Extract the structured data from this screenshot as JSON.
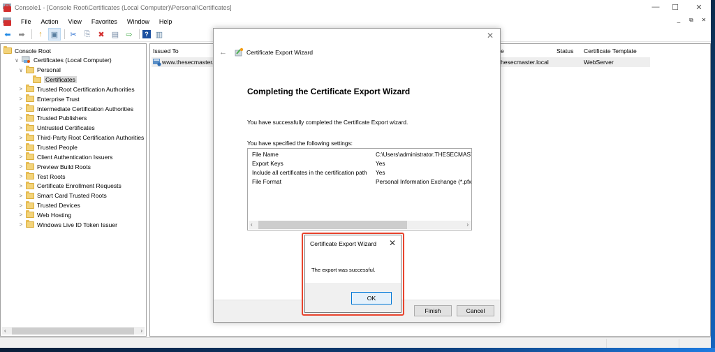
{
  "window": {
    "title": "Console1 - [Console Root\\Certificates (Local Computer)\\Personal\\Certificates]",
    "controls": {
      "minimize": "—",
      "maximize": "☐",
      "close": "✕"
    },
    "mdi_controls": {
      "minimize": "_",
      "restore": "⧉",
      "close": "✕"
    }
  },
  "menu": [
    "File",
    "Action",
    "View",
    "Favorites",
    "Window",
    "Help"
  ],
  "toolbar": [
    {
      "name": "back-icon",
      "glyph": "⬅",
      "color": "#1e88e5"
    },
    {
      "name": "forward-icon",
      "glyph": "➡",
      "color": "#888888"
    },
    {
      "name": "up-folder-icon",
      "glyph": "↑",
      "color": "#d9a52a"
    },
    {
      "name": "show-hide-tree-icon",
      "glyph": "▣",
      "color": "#5a7fa0"
    },
    {
      "name": "cut-icon",
      "glyph": "✂",
      "color": "#2a6fd0"
    },
    {
      "name": "copy-icon",
      "glyph": "⎘",
      "color": "#7a8ea8"
    },
    {
      "name": "delete-icon",
      "glyph": "✖",
      "color": "#d32f2f"
    },
    {
      "name": "properties-icon",
      "glyph": "▤",
      "color": "#7a8ea8"
    },
    {
      "name": "export-list-icon",
      "glyph": "⇨",
      "color": "#4caf50"
    },
    {
      "name": "help-icon",
      "glyph": "?",
      "color": "#1a4fa0"
    },
    {
      "name": "show-action-pane-icon",
      "glyph": "▥",
      "color": "#5a7fa0"
    }
  ],
  "tree": [
    {
      "label": "Console Root",
      "level": 0,
      "chevron": ""
    },
    {
      "label": "Certificates (Local Computer)",
      "level": 1,
      "chevron": "∨"
    },
    {
      "label": "Personal",
      "level": 2,
      "chevron": "∨"
    },
    {
      "label": "Certificates",
      "level": 3,
      "chevron": "",
      "selected": true
    },
    {
      "label": "Trusted Root Certification Authorities",
      "level": 2,
      "chevron": ">"
    },
    {
      "label": "Enterprise Trust",
      "level": 2,
      "chevron": ">"
    },
    {
      "label": "Intermediate Certification Authorities",
      "level": 2,
      "chevron": ">"
    },
    {
      "label": "Trusted Publishers",
      "level": 2,
      "chevron": ">"
    },
    {
      "label": "Untrusted Certificates",
      "level": 2,
      "chevron": ">"
    },
    {
      "label": "Third-Party Root Certification Authorities",
      "level": 2,
      "chevron": ">"
    },
    {
      "label": "Trusted People",
      "level": 2,
      "chevron": ">"
    },
    {
      "label": "Client Authentication Issuers",
      "level": 2,
      "chevron": ">"
    },
    {
      "label": "Preview Build Roots",
      "level": 2,
      "chevron": ">"
    },
    {
      "label": "Test Roots",
      "level": 2,
      "chevron": ">"
    },
    {
      "label": "Certificate Enrollment Requests",
      "level": 2,
      "chevron": ">"
    },
    {
      "label": "Smart Card Trusted Roots",
      "level": 2,
      "chevron": ">"
    },
    {
      "label": "Trusted Devices",
      "level": 2,
      "chevron": ">"
    },
    {
      "label": "Web Hosting",
      "level": 2,
      "chevron": ">"
    },
    {
      "label": "Windows Live ID Token Issuer",
      "level": 2,
      "chevron": ">"
    }
  ],
  "list": {
    "columns": {
      "issued_to": "Issued To",
      "name_partial": "e",
      "status": "Status",
      "template": "Certificate Template"
    },
    "rows": [
      {
        "issued_to": "www.thesecmaster.l",
        "name_partial": "hesecmaster.local",
        "status": "",
        "template": "WebServer"
      }
    ]
  },
  "wizard": {
    "title": "Certificate Export Wizard",
    "heading": "Completing the Certificate Export Wizard",
    "message": "You have successfully completed the Certificate Export wizard.",
    "settings_label": "You have specified the following settings:",
    "settings": [
      {
        "key": "File Name",
        "value": "C:\\Users\\administrator.THESECMASTE"
      },
      {
        "key": "Export Keys",
        "value": "Yes"
      },
      {
        "key": "Include all certificates in the certification path",
        "value": "Yes"
      },
      {
        "key": "File Format",
        "value": "Personal Information Exchange (*.pfx)"
      }
    ],
    "finish_label": "Finish",
    "cancel_label": "Cancel",
    "back_glyph": "←",
    "close_glyph": "✕"
  },
  "message_box": {
    "title": "Certificate Export Wizard",
    "text": "The export was successful.",
    "ok_label": "OK",
    "close_glyph": "✕",
    "highlight_color": "#e8442e"
  }
}
